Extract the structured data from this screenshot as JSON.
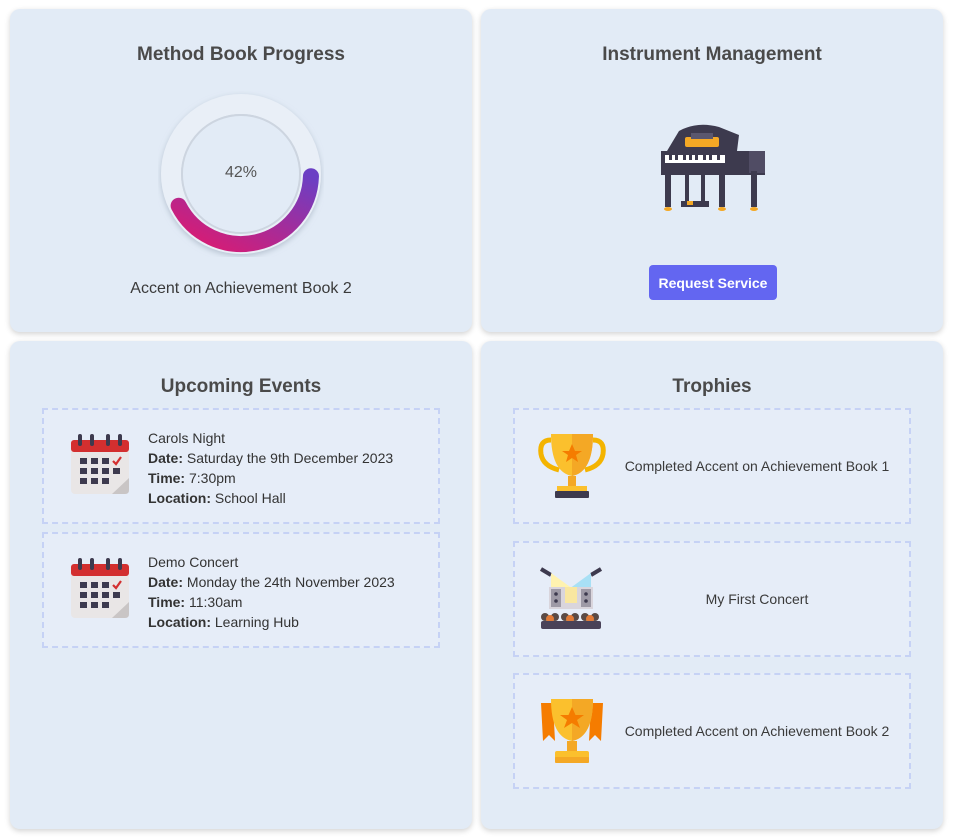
{
  "method_book": {
    "title": "Method Book Progress",
    "progress_label": "42%",
    "progress_value": 0.42,
    "book_name": "Accent on Achievement Book 2"
  },
  "instrument": {
    "title": "Instrument Management",
    "icon": "grand-piano-icon",
    "button_label": "Request Service"
  },
  "events": {
    "title": "Upcoming Events",
    "items": [
      {
        "name": "Carols Night",
        "date_label": "Date:",
        "date": "Saturday the 9th December 2023",
        "time_label": "Time:",
        "time": "7:30pm",
        "location_label": "Location:",
        "location": "School Hall"
      },
      {
        "name": "Demo Concert",
        "date_label": "Date:",
        "date": "Monday the 24th November 2023",
        "time_label": "Time:",
        "time": "11:30am",
        "location_label": "Location:",
        "location": "Learning Hub"
      }
    ]
  },
  "trophies": {
    "title": "Trophies",
    "items": [
      {
        "icon": "trophy-icon",
        "label": "Completed Accent on Achievement Book 1"
      },
      {
        "icon": "concert-stage-icon",
        "label": "My First Concert"
      },
      {
        "icon": "trophy-ribbon-icon",
        "label": "Completed Accent on Achievement Book 2"
      }
    ]
  },
  "colors": {
    "card_bg": "#e2ebf6",
    "accent_button": "#6366f1",
    "ring_start": "#e0196e",
    "ring_end": "#6b3fc4"
  }
}
